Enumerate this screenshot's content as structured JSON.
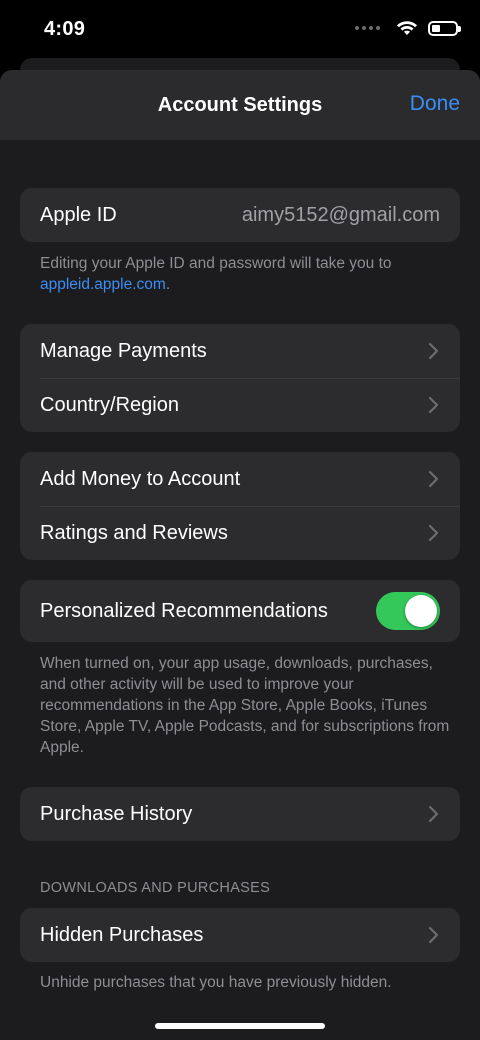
{
  "status_bar": {
    "time": "4:09"
  },
  "nav": {
    "title": "Account Settings",
    "done_label": "Done"
  },
  "apple_id": {
    "label": "Apple ID",
    "value": "aimy5152@gmail.com"
  },
  "apple_id_note": {
    "text": "Editing your Apple ID and password will take you to ",
    "link": "appleid.apple.com",
    "suffix": "."
  },
  "group1": {
    "items": [
      {
        "label": "Manage Payments"
      },
      {
        "label": "Country/Region"
      }
    ]
  },
  "group2": {
    "items": [
      {
        "label": "Add Money to Account"
      },
      {
        "label": "Ratings and Reviews"
      }
    ]
  },
  "personalized": {
    "label": "Personalized Recommendations",
    "enabled": true,
    "toggle_color": "#34c759"
  },
  "personalized_note": "When turned on, your app usage, downloads, purchases, and other activity will be used to improve your recommendations in the App Store, Apple Books, iTunes Store, Apple TV, Apple Podcasts, and for subscriptions from Apple.",
  "purchase_history": {
    "label": "Purchase History"
  },
  "downloads_section": {
    "header": "DOWNLOADS AND PURCHASES"
  },
  "hidden_purchases": {
    "label": "Hidden Purchases",
    "note": "Unhide purchases that you have previously hidden."
  },
  "colors": {
    "accent": "#3a8ef6",
    "background": "#1c1c1e",
    "cell": "#2c2c2e"
  }
}
